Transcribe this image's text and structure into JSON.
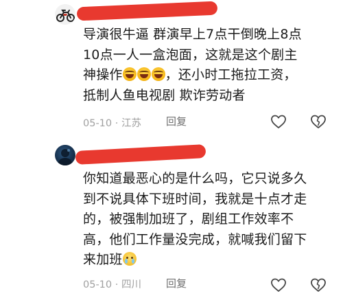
{
  "comments": [
    {
      "avatar_icon": "motorcycle-icon",
      "line1": "导演很牛逼  群演早上7点干倒晚上8点",
      "line2": "10点一人一盒泡面，这就是这个剧主",
      "line3_start": "神操作",
      "emojis": [
        "laughing-face-icon",
        "laughing-face-icon",
        "laughing-face-icon"
      ],
      "line3_end": "，还小时工拖拉工资，",
      "line4": "抵制人鱼电视剧  欺诈劳动者",
      "date": "05-10",
      "location": "江苏",
      "reply_label": "回复"
    },
    {
      "avatar_icon": "dark-portrait-avatar",
      "line1": "你知道最恶心的是什么吗，它只说多久",
      "line2": "到不说具体下班时间，我就是十点才走",
      "line3": "的，被强制加班了，剧组工作效率不",
      "line4": "高，他们工作量没完成，就喊我们留下",
      "line5_start": "来加班",
      "emoji": "crying-face-icon",
      "date": "05-10",
      "location": "四川",
      "reply_label": "回复"
    }
  ],
  "meta_separator": " · ",
  "colors": {
    "redaction": "#e8392f",
    "text": "#1a1a1a",
    "meta": "#a0a0a0",
    "reply": "#707070",
    "icon": "#444444"
  }
}
